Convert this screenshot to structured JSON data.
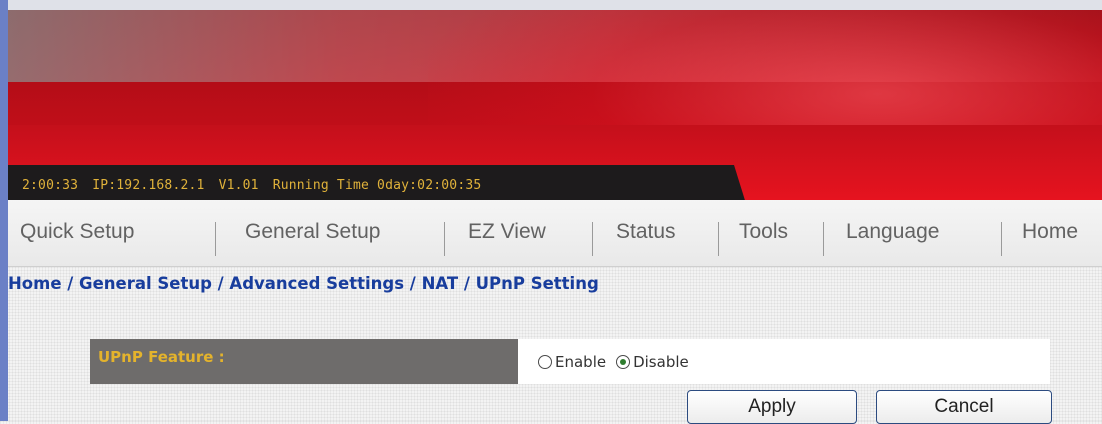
{
  "status": {
    "time": "2:00:33",
    "ip": "IP:192.168.2.1",
    "version": "V1.01",
    "running_time": "Running Time 0day:02:00:35"
  },
  "nav": {
    "items": [
      "Quick Setup",
      "General Setup",
      "EZ View",
      "Status",
      "Tools",
      "Language",
      "Home"
    ]
  },
  "breadcrumb": "Home / General Setup / Advanced Settings / NAT / UPnP Setting",
  "upnp": {
    "label": "UPnP Feature :",
    "options": [
      "Enable",
      "Disable"
    ],
    "selected": "Disable"
  },
  "buttons": {
    "apply": "Apply",
    "cancel": "Cancel"
  },
  "colors": {
    "banner_red": "#d5101d",
    "status_text": "#e0b23a",
    "breadcrumb": "#183d9d",
    "label_bg": "#6e6c6b",
    "label_text": "#e4b32c"
  }
}
